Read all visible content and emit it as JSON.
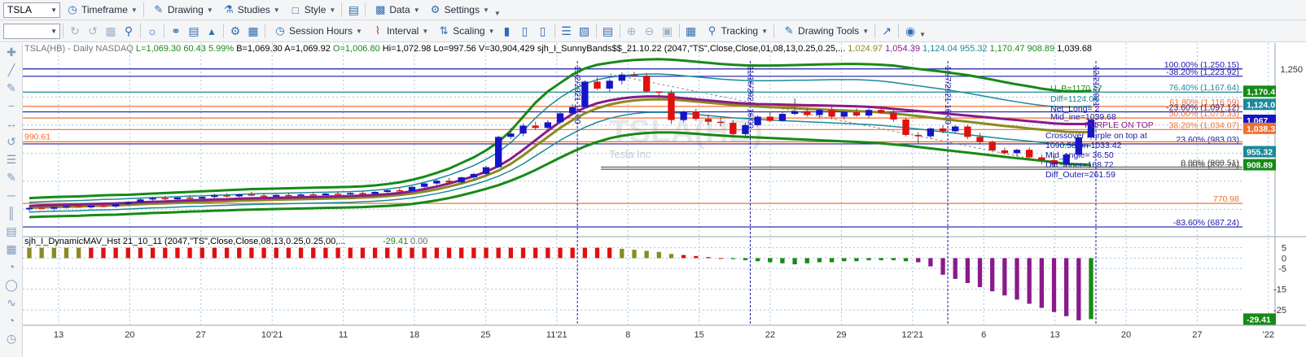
{
  "toolbar1": {
    "symbol": "TSLA",
    "timeframe": "Timeframe",
    "drawing": "Drawing",
    "studies": "Studies",
    "style": "Style",
    "data": "Data",
    "settings": "Settings"
  },
  "toolbar2": {
    "session_hours": "Session Hours",
    "interval": "Interval",
    "scaling": "Scaling",
    "tracking": "Tracking",
    "drawing_tools": "Drawing Tools"
  },
  "colors": {
    "candle_up": "#1515c8",
    "candle_down": "#e01010",
    "band_outer": "#168a16",
    "band_inner": "#1a8a99",
    "mav_purple": "#8a1a8a",
    "mav_olive": "#8a8a20",
    "fib_blue": "#1a1aaa",
    "fib_orange": "#f07030",
    "grid": "#a8c4dc"
  },
  "price_header": {
    "symbol_info": "TSLA(HB) - Daily  NASDAQ",
    "L": "L=1,069.30",
    "chg": "60.43",
    "pct": "5.99%",
    "B": "B=1,069.30",
    "A": "A=1,069.92",
    "O": "O=1,006.80",
    "Hi": "Hi=1,072.98",
    "Lo": "Lo=997.56",
    "V": "V=30,904,429",
    "study": "sjh_I_SunnyBands$$_21.10.22 (2047,\"TS\",Close,Close,01,08,13,0.25,0.25,...",
    "vals": [
      {
        "t": "1,024.97",
        "c": "#8a8a20"
      },
      {
        "t": "1,054.39",
        "c": "#8a1a8a"
      },
      {
        "t": "1,124.04",
        "c": "#1a8a99"
      },
      {
        "t": "955.32",
        "c": "#1a8a99"
      },
      {
        "t": "1,170.47",
        "c": "#168a16"
      },
      {
        "t": "908.89",
        "c": "#168a16"
      },
      {
        "t": "1,039.68",
        "c": "#000000"
      }
    ]
  },
  "watermark": {
    "symbol": "TSLA(HB)",
    "name": "Tesla Inc"
  },
  "y_axis_labels": [
    {
      "v": 1250,
      "t": "1,250"
    }
  ],
  "price_badges": [
    {
      "v": 1170.47,
      "t": "1,170.4",
      "bg": "#168a16"
    },
    {
      "v": 1124.04,
      "t": "1,124.0",
      "bg": "#1a8a99"
    },
    {
      "v": 1067,
      "t": "1,067",
      "bg": "#1515c8"
    },
    {
      "v": 1038.3,
      "t": "1,038.3",
      "bg": "#f07030"
    },
    {
      "v": 955.32,
      "t": "955.32",
      "bg": "#1a8a99"
    },
    {
      "v": 908.89,
      "t": "908.89",
      "bg": "#168a16"
    }
  ],
  "fib_levels": [
    {
      "v": 1250.15,
      "t": "100.00% (1,250.15)",
      "c": "#1a1aaa"
    },
    {
      "v": 1223.92,
      "t": "-38.20% (1,223.92)",
      "c": "#1a1aaa"
    },
    {
      "v": 1167.64,
      "t": "76.40% (1,167.64)",
      "c": "#1a8a99"
    },
    {
      "v": 1116.59,
      "t": "61.80% (1,116.59)",
      "c": "#f07030"
    },
    {
      "v": 1097.12,
      "t": "-23.60% (1,097.12)",
      "c": "#1a1aaa"
    },
    {
      "v": 1075.33,
      "t": "50.00% (1,075.33)",
      "c": "#f07030"
    },
    {
      "v": 1034.07,
      "t": "38.20% (1,034.07)",
      "c": "#f07030"
    },
    {
      "v": 983.03,
      "t": "23.60% (983.03)",
      "c": "#1a1aaa"
    },
    {
      "v": 900.51,
      "t": "0.00% (900.51)",
      "c": "#555555"
    },
    {
      "v": 892.76,
      "t": "0.00% (892.76)",
      "c": "#555555"
    },
    {
      "v": 770.98,
      "t": "770.98",
      "c": "#f07030"
    },
    {
      "v": 687.24,
      "t": "-83.60% (687.24)",
      "c": "#1a1aaa"
    }
  ],
  "left_level": {
    "v": 990.61,
    "t": "990.61"
  },
  "annotations": [
    {
      "t": "PURPLE ON TOP",
      "c": "#8a1a8a"
    },
    {
      "t": "Crossover Purple on top at",
      "c": "#1a1aaa"
    },
    {
      "t": "1090.58 on 1033.42",
      "c": "#1a1aaa"
    },
    {
      "t": "Mid_angle= 36.50",
      "c": "#1a1aaa"
    },
    {
      "t": "Diff_Inner=168.72",
      "c": "#1a1aaa"
    },
    {
      "t": "Diff_Outer=261.59",
      "c": "#1a1aaa"
    },
    {
      "t": "U_B=1170.47",
      "c": "#168a16"
    },
    {
      "t": "Diff=1124.04",
      "c": "#1a8a99"
    },
    {
      "t": "Mid_ine=1039.68",
      "c": "#1a1aaa"
    },
    {
      "t": "Net_Long= 2",
      "c": "#1a1aaa"
    }
  ],
  "date_labels_vertical": [
    "11/2/2021 16:00",
    "11/16/2021 16:00",
    "12/7/2021 16:00",
    "12/21/2021"
  ],
  "x_axis_labels": [
    "13",
    "20",
    "27",
    "10'21",
    "11",
    "18",
    "25",
    "11'21",
    "8",
    "15",
    "22",
    "29",
    "12'21",
    "6",
    "13",
    "20",
    "27",
    "'22"
  ],
  "indicator": {
    "title": "sjh_I_DynamicMAV_Hst 21_10_11 (2047,\"TS\",Close,Close,08,13,0.25,0.25,00,...",
    "value": "-29.41",
    "value2": "0.00",
    "axis_labels": [
      "5",
      "0",
      "-5",
      "-15",
      "-25"
    ],
    "badge": "-29.41"
  },
  "chart_data": {
    "type": "candlestick",
    "title": "TSLA(HB) - Daily NASDAQ",
    "ylim": [
      670,
      1290
    ],
    "candles": [
      {
        "o": 750,
        "h": 760,
        "l": 742,
        "c": 755
      },
      {
        "o": 756,
        "h": 762,
        "l": 748,
        "c": 752
      },
      {
        "o": 752,
        "h": 760,
        "l": 745,
        "c": 758
      },
      {
        "o": 758,
        "h": 766,
        "l": 752,
        "c": 761
      },
      {
        "o": 761,
        "h": 768,
        "l": 756,
        "c": 757
      },
      {
        "o": 757,
        "h": 766,
        "l": 752,
        "c": 763
      },
      {
        "o": 763,
        "h": 770,
        "l": 758,
        "c": 760
      },
      {
        "o": 760,
        "h": 772,
        "l": 755,
        "c": 768
      },
      {
        "o": 768,
        "h": 780,
        "l": 762,
        "c": 775
      },
      {
        "o": 775,
        "h": 790,
        "l": 770,
        "c": 785
      },
      {
        "o": 785,
        "h": 795,
        "l": 778,
        "c": 790
      },
      {
        "o": 790,
        "h": 798,
        "l": 782,
        "c": 786
      },
      {
        "o": 786,
        "h": 796,
        "l": 780,
        "c": 792
      },
      {
        "o": 792,
        "h": 800,
        "l": 784,
        "c": 788
      },
      {
        "o": 788,
        "h": 798,
        "l": 782,
        "c": 794
      },
      {
        "o": 794,
        "h": 806,
        "l": 790,
        "c": 800
      },
      {
        "o": 800,
        "h": 808,
        "l": 792,
        "c": 796
      },
      {
        "o": 796,
        "h": 806,
        "l": 790,
        "c": 803
      },
      {
        "o": 803,
        "h": 812,
        "l": 798,
        "c": 799
      },
      {
        "o": 799,
        "h": 806,
        "l": 792,
        "c": 795
      },
      {
        "o": 795,
        "h": 804,
        "l": 790,
        "c": 801
      },
      {
        "o": 801,
        "h": 810,
        "l": 796,
        "c": 798
      },
      {
        "o": 798,
        "h": 806,
        "l": 792,
        "c": 803
      },
      {
        "o": 803,
        "h": 812,
        "l": 798,
        "c": 800
      },
      {
        "o": 800,
        "h": 808,
        "l": 794,
        "c": 806
      },
      {
        "o": 806,
        "h": 814,
        "l": 800,
        "c": 803
      },
      {
        "o": 803,
        "h": 812,
        "l": 798,
        "c": 808
      },
      {
        "o": 808,
        "h": 816,
        "l": 802,
        "c": 805
      },
      {
        "o": 805,
        "h": 814,
        "l": 800,
        "c": 812
      },
      {
        "o": 812,
        "h": 822,
        "l": 806,
        "c": 818
      },
      {
        "o": 818,
        "h": 826,
        "l": 812,
        "c": 815
      },
      {
        "o": 815,
        "h": 832,
        "l": 812,
        "c": 830
      },
      {
        "o": 830,
        "h": 845,
        "l": 826,
        "c": 842
      },
      {
        "o": 842,
        "h": 856,
        "l": 836,
        "c": 852
      },
      {
        "o": 852,
        "h": 862,
        "l": 840,
        "c": 846
      },
      {
        "o": 846,
        "h": 866,
        "l": 842,
        "c": 864
      },
      {
        "o": 864,
        "h": 880,
        "l": 858,
        "c": 876
      },
      {
        "o": 876,
        "h": 904,
        "l": 870,
        "c": 900
      },
      {
        "o": 900,
        "h": 1012,
        "l": 898,
        "c": 1008
      },
      {
        "o": 1008,
        "h": 1040,
        "l": 1000,
        "c": 1020
      },
      {
        "o": 1020,
        "h": 1056,
        "l": 1010,
        "c": 1048
      },
      {
        "o": 1048,
        "h": 1062,
        "l": 1032,
        "c": 1040
      },
      {
        "o": 1040,
        "h": 1068,
        "l": 1036,
        "c": 1060
      },
      {
        "o": 1060,
        "h": 1098,
        "l": 1054,
        "c": 1092
      },
      {
        "o": 1092,
        "h": 1126,
        "l": 1084,
        "c": 1114
      },
      {
        "o": 1114,
        "h": 1210,
        "l": 1110,
        "c": 1205
      },
      {
        "o": 1205,
        "h": 1220,
        "l": 1175,
        "c": 1180
      },
      {
        "o": 1180,
        "h": 1215,
        "l": 1168,
        "c": 1208
      },
      {
        "o": 1208,
        "h": 1238,
        "l": 1195,
        "c": 1230
      },
      {
        "o": 1230,
        "h": 1240,
        "l": 1222,
        "c": 1226
      },
      {
        "o": 1226,
        "h": 1236,
        "l": 1165,
        "c": 1170
      },
      {
        "o": 1170,
        "h": 1170,
        "l": 1145,
        "c": 1165
      },
      {
        "o": 1165,
        "h": 1175,
        "l": 1055,
        "c": 1068
      },
      {
        "o": 1068,
        "h": 1102,
        "l": 1060,
        "c": 1098
      },
      {
        "o": 1098,
        "h": 1108,
        "l": 1065,
        "c": 1072
      },
      {
        "o": 1072,
        "h": 1088,
        "l": 1050,
        "c": 1062
      },
      {
        "o": 1062,
        "h": 1078,
        "l": 1045,
        "c": 1058
      },
      {
        "o": 1058,
        "h": 1068,
        "l": 1008,
        "c": 1018
      },
      {
        "o": 1018,
        "h": 1058,
        "l": 1012,
        "c": 1050
      },
      {
        "o": 1050,
        "h": 1085,
        "l": 1045,
        "c": 1080
      },
      {
        "o": 1080,
        "h": 1098,
        "l": 1060,
        "c": 1065
      },
      {
        "o": 1065,
        "h": 1095,
        "l": 1062,
        "c": 1090
      },
      {
        "o": 1090,
        "h": 1145,
        "l": 1085,
        "c": 1100
      },
      {
        "o": 1100,
        "h": 1112,
        "l": 1080,
        "c": 1086
      },
      {
        "o": 1086,
        "h": 1108,
        "l": 1074,
        "c": 1104
      },
      {
        "o": 1104,
        "h": 1116,
        "l": 1074,
        "c": 1080
      },
      {
        "o": 1080,
        "h": 1102,
        "l": 1070,
        "c": 1096
      },
      {
        "o": 1096,
        "h": 1110,
        "l": 1080,
        "c": 1084
      },
      {
        "o": 1084,
        "h": 1110,
        "l": 1076,
        "c": 1104
      },
      {
        "o": 1104,
        "h": 1118,
        "l": 1090,
        "c": 1094
      },
      {
        "o": 1094,
        "h": 1110,
        "l": 1062,
        "c": 1070
      },
      {
        "o": 1070,
        "h": 1076,
        "l": 1010,
        "c": 1015
      },
      {
        "o": 1015,
        "h": 1025,
        "l": 985,
        "c": 1010
      },
      {
        "o": 1010,
        "h": 1042,
        "l": 1002,
        "c": 1038
      },
      {
        "o": 1038,
        "h": 1050,
        "l": 1020,
        "c": 1028
      },
      {
        "o": 1028,
        "h": 1050,
        "l": 1022,
        "c": 1045
      },
      {
        "o": 1045,
        "h": 1052,
        "l": 1000,
        "c": 1008
      },
      {
        "o": 1008,
        "h": 1022,
        "l": 985,
        "c": 990
      },
      {
        "o": 990,
        "h": 995,
        "l": 955,
        "c": 960
      },
      {
        "o": 960,
        "h": 970,
        "l": 945,
        "c": 950
      },
      {
        "o": 950,
        "h": 966,
        "l": 938,
        "c": 962
      },
      {
        "o": 962,
        "h": 970,
        "l": 930,
        "c": 935
      },
      {
        "o": 935,
        "h": 945,
        "l": 910,
        "c": 925
      },
      {
        "o": 925,
        "h": 940,
        "l": 900,
        "c": 910
      },
      {
        "o": 910,
        "h": 950,
        "l": 905,
        "c": 945
      },
      {
        "o": 945,
        "h": 1010,
        "l": 940,
        "c": 1006
      },
      {
        "o": 1006,
        "h": 1072.98,
        "l": 997.56,
        "c": 1069.3
      }
    ],
    "band_outer_upper": [
      790,
      792,
      794,
      795,
      796,
      798,
      800,
      801,
      802,
      804,
      806,
      808,
      810,
      812,
      814,
      816,
      818,
      820,
      822,
      823,
      824,
      825,
      826,
      827,
      828,
      829,
      830,
      832,
      835,
      840,
      846,
      855,
      866,
      880,
      895,
      915,
      935,
      960,
      990,
      1030,
      1080,
      1130,
      1170,
      1200,
      1230,
      1252,
      1265,
      1272,
      1278,
      1282,
      1284,
      1285,
      1283,
      1280,
      1276,
      1272,
      1268,
      1265,
      1263,
      1262,
      1262,
      1263,
      1264,
      1265,
      1266,
      1267,
      1268,
      1268,
      1267,
      1265,
      1262,
      1256,
      1250,
      1245,
      1240,
      1234,
      1228,
      1220,
      1212,
      1203,
      1195,
      1188,
      1180,
      1174,
      1170,
      1170,
      1172
    ],
    "band_inner_upper": [
      775,
      777,
      779,
      780,
      781,
      783,
      785,
      786,
      788,
      790,
      792,
      793,
      795,
      797,
      798,
      800,
      801,
      803,
      805,
      806,
      807,
      808,
      809,
      810,
      811,
      812,
      813,
      815,
      818,
      822,
      828,
      836,
      846,
      858,
      872,
      888,
      906,
      928,
      954,
      988,
      1030,
      1075,
      1115,
      1148,
      1175,
      1197,
      1212,
      1220,
      1226,
      1230,
      1232,
      1232,
      1230,
      1226,
      1222,
      1218,
      1214,
      1211,
      1209,
      1208,
      1208,
      1209,
      1210,
      1210,
      1211,
      1212,
      1212,
      1212,
      1210,
      1207,
      1202,
      1196,
      1190,
      1184,
      1178,
      1171,
      1164,
      1156,
      1148,
      1140,
      1133,
      1126,
      1120,
      1116,
      1114,
      1115,
      1118
    ],
    "mav_purple": [
      762,
      764,
      765,
      766,
      767,
      769,
      770,
      771,
      773,
      775,
      777,
      778,
      780,
      782,
      783,
      785,
      786,
      788,
      789,
      790,
      791,
      792,
      793,
      794,
      795,
      796,
      797,
      799,
      801,
      804,
      808,
      814,
      822,
      831,
      842,
      854,
      868,
      884,
      904,
      930,
      962,
      996,
      1030,
      1062,
      1090,
      1112,
      1128,
      1138,
      1145,
      1150,
      1152,
      1152,
      1150,
      1146,
      1142,
      1138,
      1134,
      1130,
      1127,
      1125,
      1124,
      1123,
      1122,
      1121,
      1120,
      1119,
      1118,
      1117,
      1115,
      1112,
      1108,
      1104,
      1100,
      1096,
      1092,
      1088,
      1084,
      1080,
      1076,
      1072,
      1068,
      1064,
      1060,
      1056,
      1054,
      1054,
      1054
    ],
    "mav_olive": [
      755,
      757,
      758,
      759,
      760,
      762,
      763,
      764,
      766,
      768,
      770,
      771,
      773,
      775,
      776,
      778,
      779,
      781,
      782,
      783,
      784,
      785,
      786,
      787,
      788,
      789,
      790,
      792,
      794,
      797,
      801,
      806,
      813,
      821,
      831,
      842,
      855,
      870,
      888,
      912,
      942,
      975,
      1008,
      1040,
      1068,
      1092,
      1110,
      1123,
      1132,
      1138,
      1141,
      1142,
      1141,
      1138,
      1134,
      1130,
      1126,
      1122,
      1119,
      1116,
      1114,
      1112,
      1110,
      1108,
      1106,
      1104,
      1102,
      1100,
      1098,
      1095,
      1091,
      1087,
      1082,
      1077,
      1072,
      1067,
      1062,
      1057,
      1052,
      1047,
      1043,
      1038,
      1034,
      1030,
      1026,
      1025,
      1025
    ],
    "band_inner_lower": [
      740,
      742,
      743,
      744,
      745,
      747,
      748,
      749,
      751,
      753,
      755,
      756,
      758,
      760,
      761,
      763,
      764,
      766,
      767,
      768,
      769,
      770,
      771,
      772,
      773,
      774,
      775,
      777,
      779,
      782,
      786,
      791,
      798,
      806,
      815,
      826,
      838,
      852,
      868,
      888,
      912,
      940,
      968,
      996,
      1020,
      1042,
      1060,
      1074,
      1084,
      1091,
      1095,
      1096,
      1095,
      1092,
      1088,
      1084,
      1080,
      1076,
      1073,
      1070,
      1068,
      1066,
      1064,
      1062,
      1060,
      1058,
      1056,
      1054,
      1052,
      1049,
      1045,
      1041,
      1036,
      1031,
      1026,
      1021,
      1016,
      1011,
      1006,
      1001,
      997,
      993,
      988,
      984,
      980,
      978,
      976
    ],
    "band_outer_lower": [
      722,
      724,
      725,
      726,
      727,
      729,
      730,
      731,
      733,
      735,
      737,
      738,
      740,
      742,
      743,
      745,
      746,
      748,
      749,
      750,
      751,
      752,
      753,
      754,
      755,
      756,
      757,
      758,
      760,
      762,
      765,
      769,
      775,
      782,
      790,
      800,
      811,
      823,
      836,
      852,
      870,
      890,
      912,
      934,
      955,
      974,
      990,
      1003,
      1012,
      1018,
      1022,
      1024,
      1024,
      1022,
      1019,
      1016,
      1013,
      1010,
      1008,
      1006,
      1004,
      1002,
      1000,
      998,
      996,
      994,
      992,
      990,
      988,
      985,
      981,
      977,
      972,
      967,
      962,
      957,
      952,
      947,
      942,
      937,
      932,
      928,
      923,
      918,
      912,
      910,
      908
    ],
    "histogram": [
      5,
      5,
      5,
      5,
      5,
      5,
      5,
      5,
      5,
      5,
      5,
      5,
      5,
      5,
      5,
      5,
      5,
      5,
      5,
      5,
      5,
      5,
      5,
      5,
      5,
      5,
      5,
      5,
      5,
      5,
      5,
      5,
      5,
      5,
      5,
      5,
      5,
      5,
      5,
      5,
      5,
      5,
      5,
      5,
      5,
      5,
      5,
      5,
      4.5,
      4,
      3.5,
      3,
      2,
      1.5,
      1,
      0.5,
      0,
      -0.5,
      -1,
      -1.5,
      -2,
      -2.5,
      -3,
      -2.5,
      -2,
      -2,
      -1.5,
      -1.5,
      -1,
      -1,
      -1,
      -1.5,
      -2,
      -4,
      -8,
      -10,
      -12,
      -14,
      -16,
      -18,
      -20,
      -22,
      -24,
      -26,
      -28,
      -30,
      -29.41
    ]
  }
}
